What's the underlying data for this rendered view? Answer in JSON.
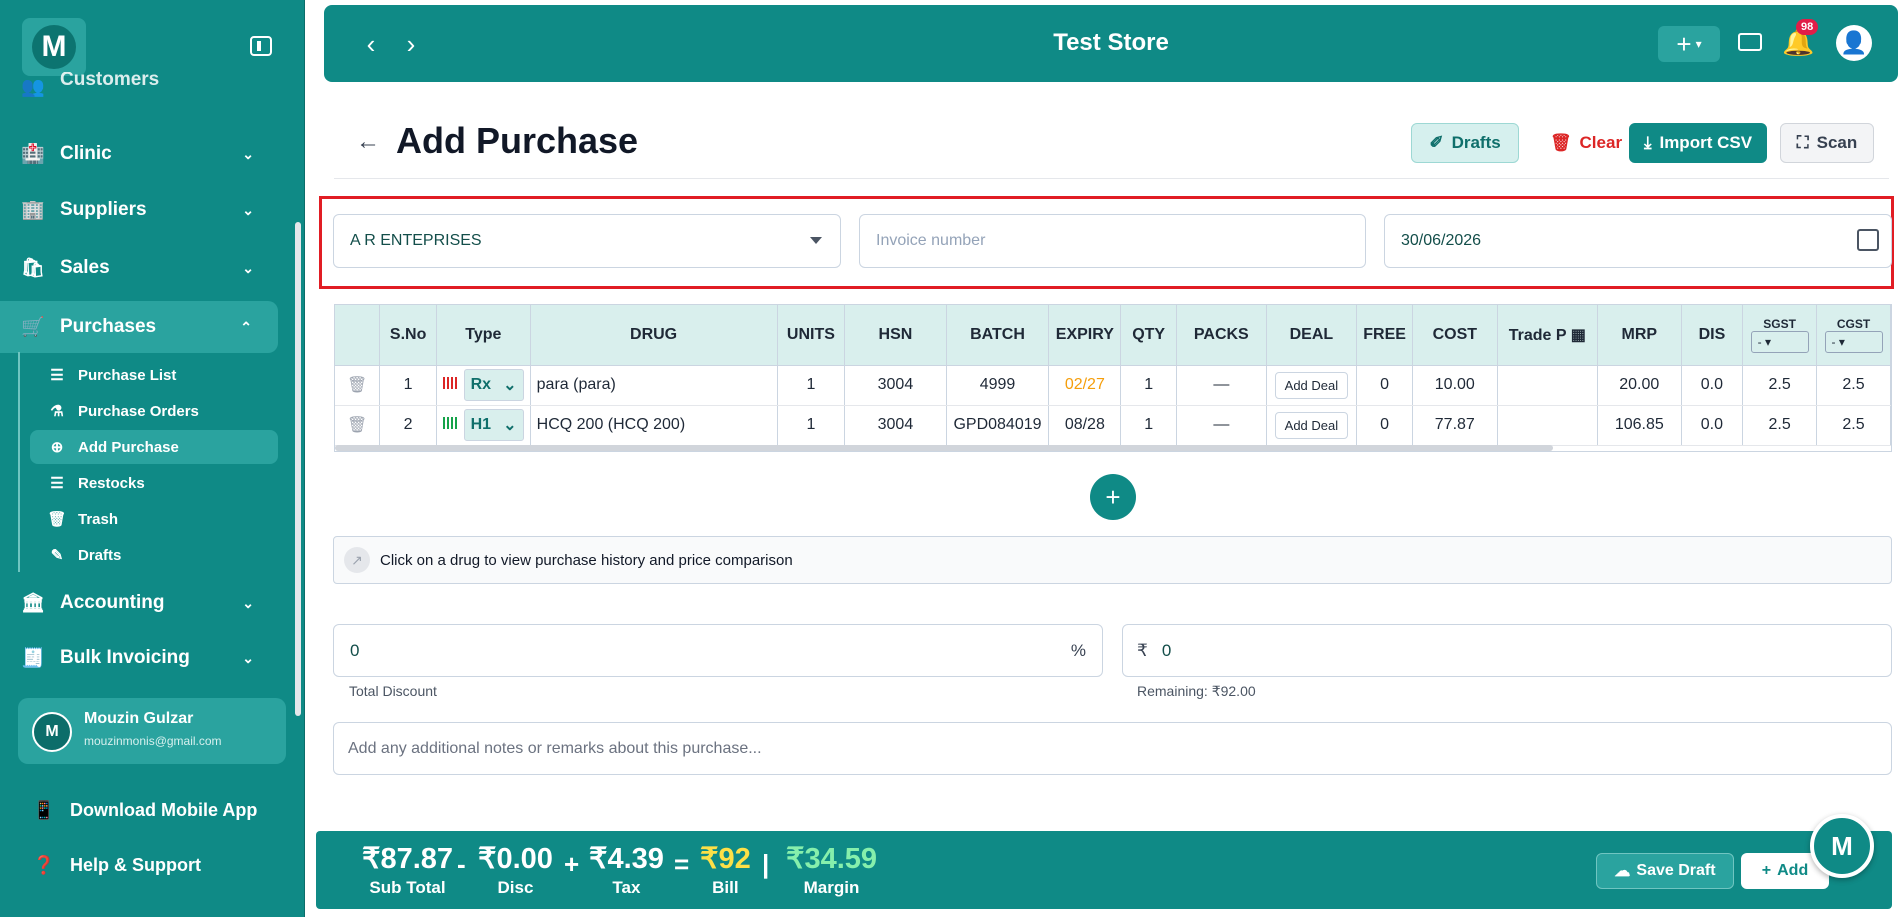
{
  "sidebar": {
    "logo_letter": "M",
    "partial_item": "Customers",
    "items": [
      {
        "label": "Clinic",
        "icon": "hospital-icon"
      },
      {
        "label": "Suppliers",
        "icon": "building-icon"
      },
      {
        "label": "Sales",
        "icon": "shopping-bag-icon"
      },
      {
        "label": "Purchases",
        "icon": "cart-icon"
      },
      {
        "label": "Accounting",
        "icon": "bank-icon"
      },
      {
        "label": "Bulk Invoicing",
        "icon": "invoice-icon"
      }
    ],
    "sub_items": [
      {
        "label": "Purchase List"
      },
      {
        "label": "Purchase Orders"
      },
      {
        "label": "Add Purchase"
      },
      {
        "label": "Restocks"
      },
      {
        "label": "Trash"
      },
      {
        "label": "Drafts"
      }
    ],
    "user": {
      "initial": "M",
      "name": "Mouzin Gulzar",
      "email": "mouzinmonis@gmail.com"
    },
    "download_app": "Download Mobile App",
    "help": "Help & Support"
  },
  "topbar": {
    "title": "Test Store",
    "notifications": "98"
  },
  "page": {
    "title": "Add Purchase",
    "actions": {
      "drafts": "Drafts",
      "clear": "Clear",
      "import_csv": "Import CSV",
      "scan": "Scan"
    }
  },
  "form": {
    "supplier": "A R ENTEPRISES",
    "invoice_placeholder": "Invoice number",
    "date": "30/06/2026"
  },
  "table": {
    "headers": [
      "S.No",
      "Type",
      "DRUG",
      "UNITS",
      "HSN",
      "BATCH",
      "EXPIRY",
      "QTY",
      "PACKS",
      "DEAL",
      "FREE",
      "COST",
      "Trade P",
      "MRP",
      "DIS",
      "SGST",
      "CGST"
    ],
    "gst_default": "-",
    "add_deal_label": "Add Deal",
    "rows": [
      {
        "sno": "1",
        "type": "Rx",
        "drug": "para (para)",
        "units": "1",
        "hsn": "3004",
        "batch": "4999",
        "expiry": "02/27",
        "qty": "1",
        "packs": "—",
        "free": "0",
        "cost": "10.00",
        "trade": "",
        "mrp": "20.00",
        "dis": "0.0",
        "sgst": "2.5",
        "cgst": "2.5"
      },
      {
        "sno": "2",
        "type": "H1",
        "drug": "HCQ 200 (HCQ 200)",
        "units": "1",
        "hsn": "3004",
        "batch": "GPD084019",
        "expiry": "08/28",
        "qty": "1",
        "packs": "—",
        "free": "0",
        "cost": "77.87",
        "trade": "",
        "mrp": "106.85",
        "dis": "0.0",
        "sgst": "2.5",
        "cgst": "2.5"
      }
    ]
  },
  "info_text": "Click on a drug to view purchase history and price comparison",
  "discount": {
    "percent_value": "0",
    "percent_symbol": "%",
    "rupee_symbol": "₹",
    "amount_value": "0",
    "label": "Total Discount",
    "remaining": "Remaining: ₹92.00"
  },
  "notes_placeholder": "Add any additional notes or remarks about this purchase...",
  "totals": {
    "subtotal": "₹87.87",
    "subtotal_label": "Sub Total",
    "disc": "₹0.00",
    "disc_label": "Disc",
    "tax": "₹4.39",
    "tax_label": "Tax",
    "bill": "₹92",
    "bill_label": "Bill",
    "margin": "₹34.59",
    "margin_label": "Margin"
  },
  "footer_actions": {
    "save_draft": "Save Draft",
    "add": "Add"
  },
  "colors": {
    "primary": "#0f8a86",
    "accent_light": "#2aa39f",
    "highlight": "#e11d24",
    "bill": "#fde047",
    "margin": "#86efac"
  }
}
